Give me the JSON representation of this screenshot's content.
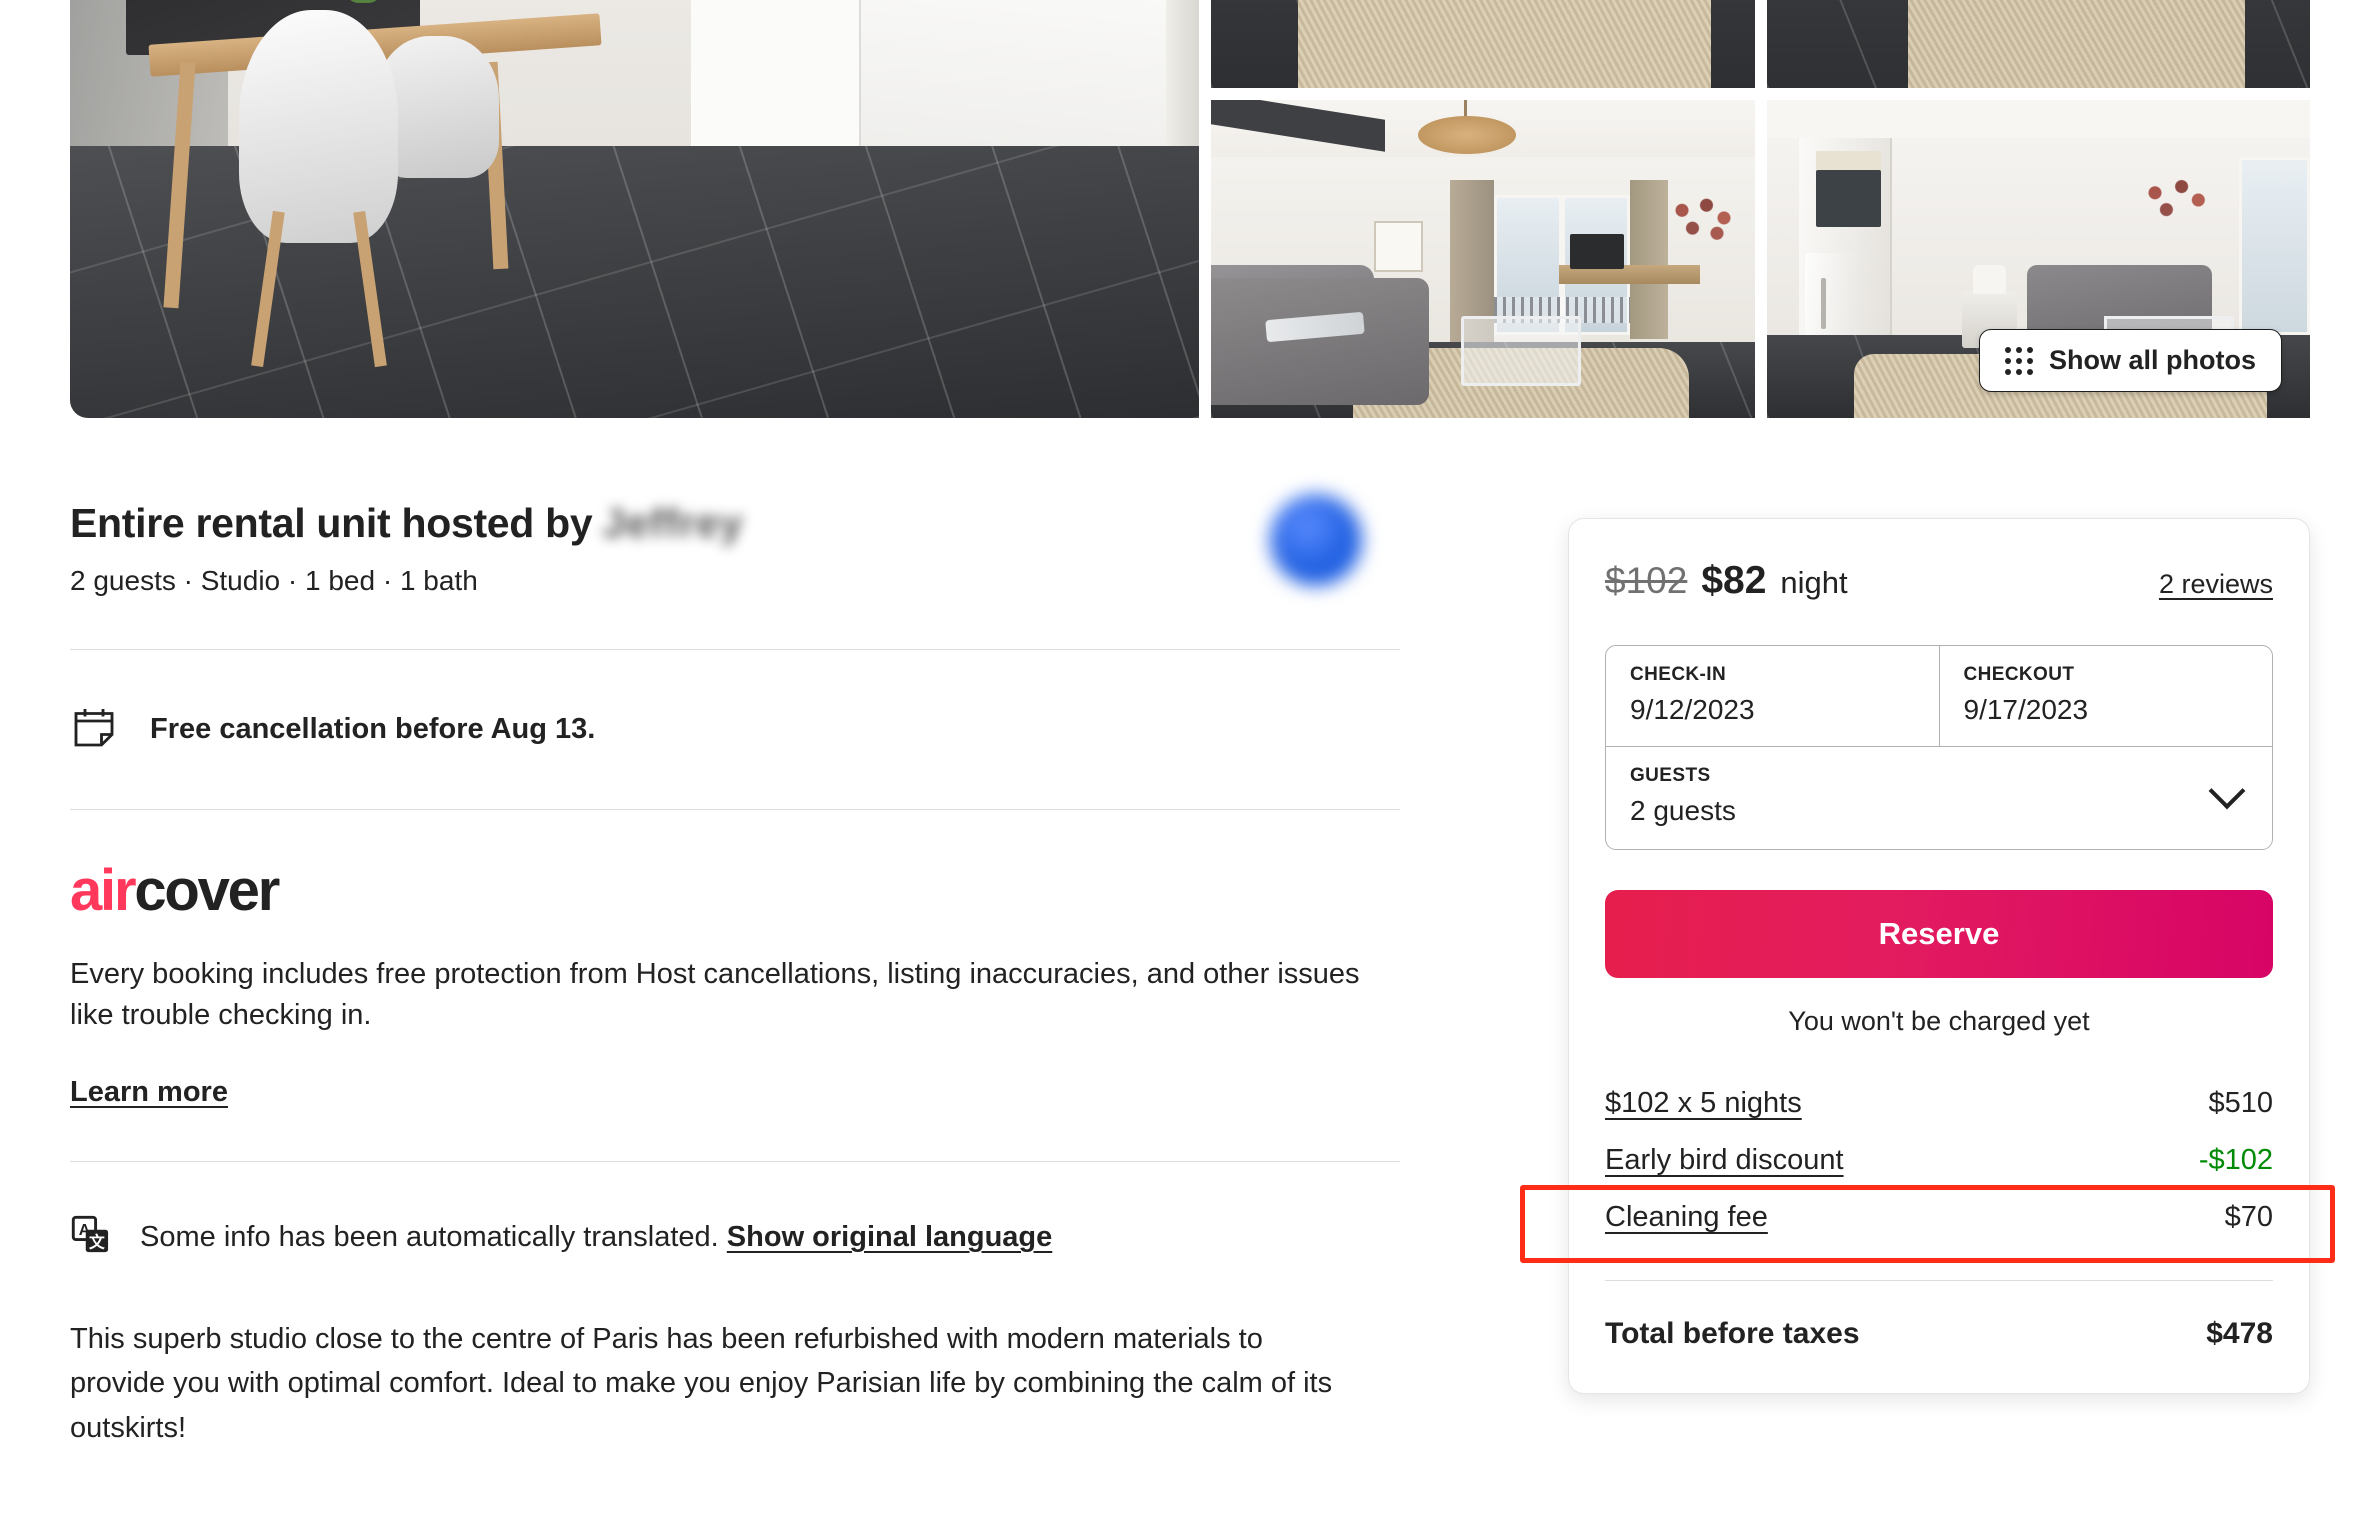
{
  "gallery": {
    "show_all_photos_label": "Show all photos",
    "grid_icon": "grid-dots-icon",
    "photos": [
      {
        "alt": "Kitchen with dining table and white chairs"
      },
      {
        "alt": "Living room ceiling detail"
      },
      {
        "alt": "Living room with sofa, window and pendant lamp"
      },
      {
        "alt": "Living room rug detail"
      },
      {
        "alt": "Living area with sofa and kitchen partition"
      }
    ]
  },
  "listing": {
    "title_prefix": "Entire rental unit hosted by",
    "host_name": "Jeffrey",
    "details": "2 guests · Studio · 1 bed · 1 bath",
    "avatar": "host-avatar"
  },
  "cancellation": {
    "icon": "calendar-icon",
    "text": "Free cancellation before Aug 13."
  },
  "aircover": {
    "logo_air": "air",
    "logo_cover": "cover",
    "description": "Every booking includes free protection from Host cancellations, listing inaccuracies, and other issues like trouble checking in.",
    "learn_more_label": "Learn more"
  },
  "translation": {
    "icon": "translate-icon",
    "notice": "Some info has been automatically translated.",
    "show_original_label": "Show original language"
  },
  "description": "This superb studio close to the centre of Paris has been refurbished with modern materials to provide you with optimal comfort. Ideal to make you enjoy Parisian life by combining the calm of its outskirts!",
  "booking": {
    "price_original": "$102",
    "price_current": "$82",
    "price_unit": "night",
    "reviews_label": "2 reviews",
    "checkin_label": "CHECK-IN",
    "checkin_value": "9/12/2023",
    "checkout_label": "CHECKOUT",
    "checkout_value": "9/17/2023",
    "guests_label": "GUESTS",
    "guests_value": "2 guests",
    "guests_chevron": "chevron-down-icon",
    "reserve_label": "Reserve",
    "charge_note": "You won't be charged yet",
    "fees": [
      {
        "label": "$102 x 5 nights",
        "amount": "$510",
        "discount": false
      },
      {
        "label": "Early bird discount",
        "amount": "-$102",
        "discount": true
      },
      {
        "label": "Cleaning fee",
        "amount": "$70",
        "discount": false
      }
    ],
    "total_label": "Total before taxes",
    "total_amount": "$478"
  },
  "annotation": {
    "target": "early-bird-discount-row",
    "color": "#FF2D16"
  },
  "colors": {
    "brand_pink": "#FF385C",
    "reserve_gradient_start": "#E61E4D",
    "reserve_gradient_end": "#D70466",
    "discount_green": "#008A05",
    "annotation_red": "#FF2D16"
  }
}
